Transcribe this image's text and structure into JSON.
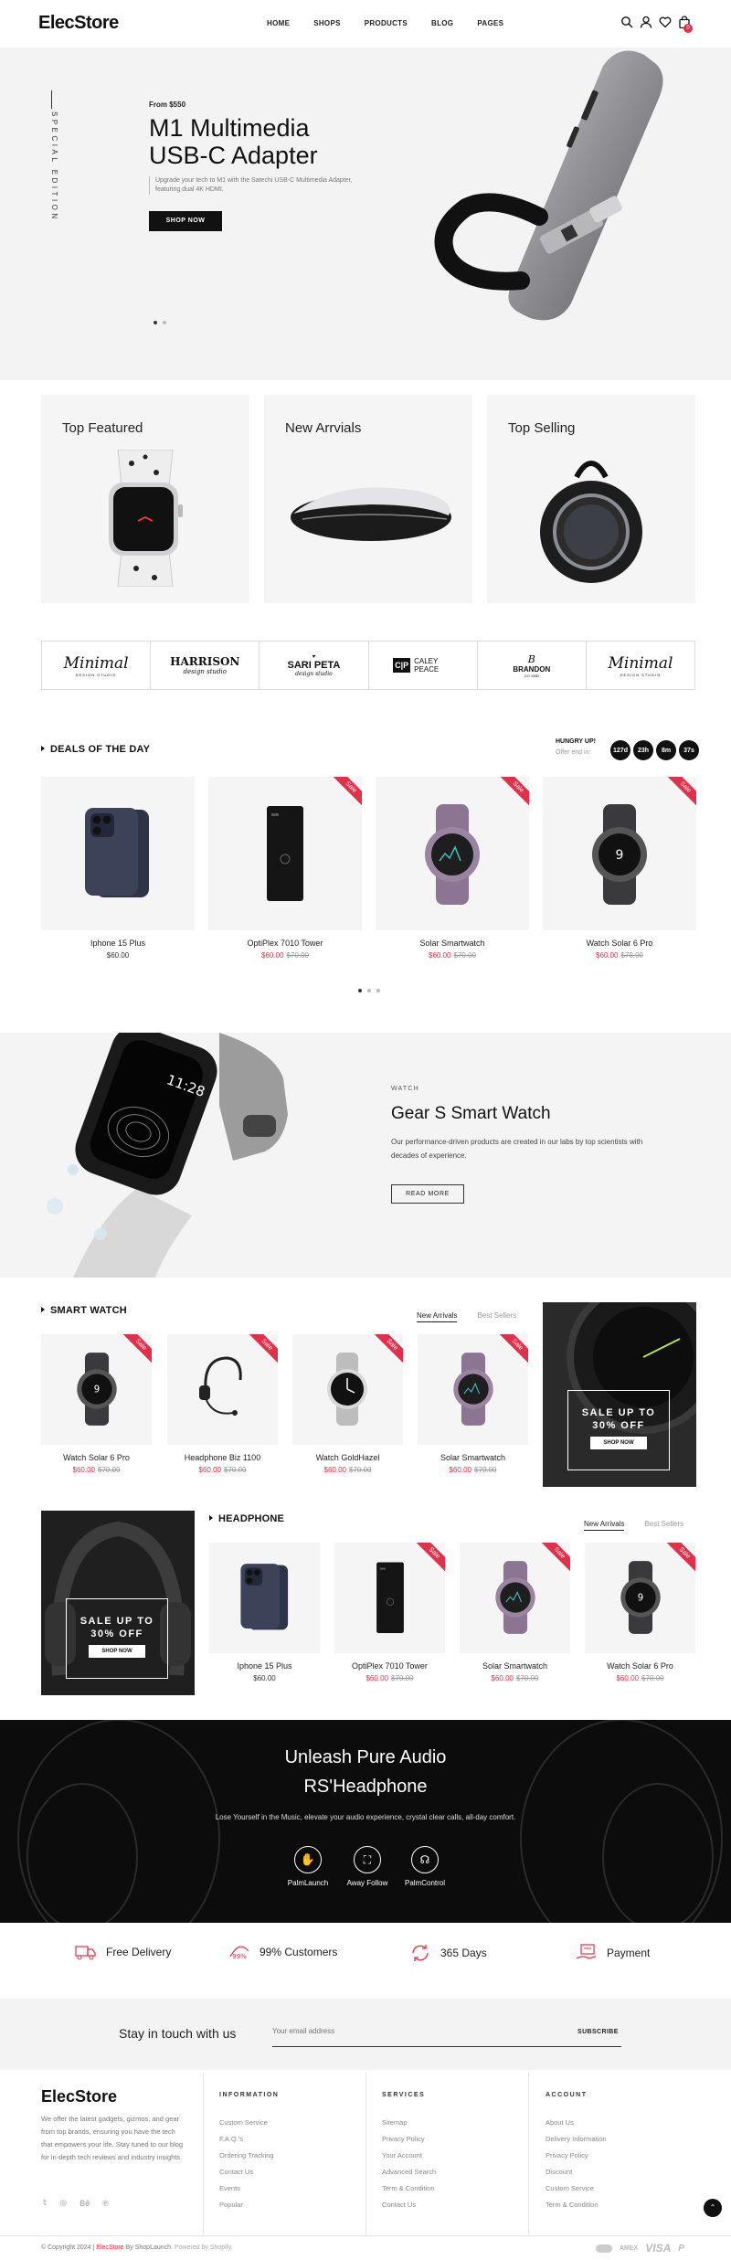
{
  "header": {
    "logo": "ElecStore",
    "nav": [
      "HOME",
      "SHOPS",
      "PRODUCTS",
      "BLOG",
      "PAGES"
    ],
    "cart_count": "0"
  },
  "hero": {
    "vertical_text": "SPECIAL EDITION",
    "price_line": "From $550",
    "title_line1": "M1 Multimedia",
    "title_line2": "USB-C Adapter",
    "description": "Upgrade your tech to M1 with the Satechi USB-C Multimedia Adapter, featuring dual 4K HDMI.",
    "button": "SHOP NOW"
  },
  "categories": [
    {
      "label": "Top Featured"
    },
    {
      "label": "New Arrvials"
    },
    {
      "label": "Top Selling"
    }
  ],
  "brands": [
    {
      "name": "Minimal",
      "sub": "DESIGN STUDIO"
    },
    {
      "name": "HARRISON",
      "sub": "design studio"
    },
    {
      "name": "SARI PETA",
      "sub": "design studio"
    },
    {
      "name": "CALEY PEACE",
      "sub": ""
    },
    {
      "name": "BRANDON",
      "sub": "CO 1980"
    },
    {
      "name": "Minimal",
      "sub": "DESIGN STUDIO"
    }
  ],
  "deals": {
    "title": "DEALS OF THE DAY",
    "hungry": "HUNGRY UP!",
    "offer": "Offer end in:",
    "timer": [
      "127d",
      "23h",
      "8m",
      "37s"
    ],
    "products": [
      {
        "name": "Iphone 15 Plus",
        "price": "$60.00",
        "old": "",
        "sale": false
      },
      {
        "name": "OptiPlex 7010 Tower",
        "price": "$60.00",
        "old": "$70.00",
        "sale": true
      },
      {
        "name": "Solar Smartwatch",
        "price": "$60.00",
        "old": "$70.00",
        "sale": true
      },
      {
        "name": "Watch Solar 6 Pro",
        "price": "$60.00",
        "old": "$70.00",
        "sale": true
      }
    ]
  },
  "watch_banner": {
    "tag": "WATCH",
    "title": "Gear S Smart Watch",
    "desc": "Our performance-driven products are created in our labs by top scientists with decades of experience.",
    "button": "READ MORE",
    "screen_time": "11:28"
  },
  "smartwatch": {
    "title": "SMART WATCH",
    "tab_new": "New Arrivals",
    "tab_best": "Best Sellers",
    "promo_line1": "SALE UP TO",
    "promo_line2": "30% OFF",
    "promo_button": "SHOP NOW",
    "products": [
      {
        "name": "Watch Solar 6 Pro",
        "price": "$60.00",
        "old": "$70.00"
      },
      {
        "name": "Headphone Biz 1100",
        "price": "$60.00",
        "old": "$70.00"
      },
      {
        "name": "Watch GoldHazel",
        "price": "$60.00",
        "old": "$70.00"
      },
      {
        "name": "Solar Smartwatch",
        "price": "$60.00",
        "old": "$70.00"
      }
    ]
  },
  "headphone": {
    "title": "HEADPHONE",
    "tab_new": "New Arrivals",
    "tab_best": "Best Sellers",
    "promo_line1": "SALE UP TO",
    "promo_line2": "30% OFF",
    "promo_button": "SHOP NOW",
    "products": [
      {
        "name": "Iphone 15 Plus",
        "price": "$60.00",
        "old": "",
        "sale": false
      },
      {
        "name": "OptiPlex 7010 Tower",
        "price": "$60.00",
        "old": "$70.00",
        "sale": true
      },
      {
        "name": "Solar Smartwatch",
        "price": "$60.00",
        "old": "$70.00",
        "sale": true
      },
      {
        "name": "Watch Solar 6 Pro",
        "price": "$60.00",
        "old": "$70.00",
        "sale": true
      }
    ]
  },
  "audio": {
    "line1": "Unleash Pure Audio",
    "line2": "RS'Headphone",
    "desc": "Lose Yourself in the Music, elevate your audio experience, crystal clear calls, all-day comfort.",
    "features": [
      "PalmLaunch",
      "Away Follow",
      "PalmControl"
    ]
  },
  "features": [
    "Free Delivery",
    "99% Customers",
    "365 Days",
    "Payment"
  ],
  "feature_badge": "99%",
  "newsletter": {
    "title": "Stay in touch with us",
    "placeholder": "Your email address",
    "button": "SUBSCRIBE"
  },
  "footer": {
    "logo": "ElecStore",
    "about": "We offer the latest gadgets, gizmos, and gear from top brands, ensuring you have the tech that empowers your life. Stay tuned to our blog for in-depth tech reviews and industry insights.",
    "info_title": "INFORMATION",
    "info": [
      "Custom Service",
      "F.A.Q.'s",
      "Ordering Tracking",
      "Contact Us",
      "Events",
      "Popular"
    ],
    "services_title": "SERVICES",
    "services": [
      "Sitemap",
      "Privacy Policy",
      "Your Account",
      "Advanced Search",
      "Term & Condition",
      "Contact Us"
    ],
    "account_title": "ACCOUNT",
    "account": [
      "About Us",
      "Delivery Information",
      "Privacy Policy",
      "Discount",
      "Custom Service",
      "Term & Condition"
    ],
    "copyright_pre": "© Copyright 2024 | ",
    "copyright_brand": "ElecStore",
    "copyright_by": " By ShopLaunch",
    "powered": ". Powered by Shopify.",
    "pay": [
      "AMEX",
      "VISA"
    ]
  },
  "colors": {
    "accent": "#e0314b",
    "dark": "#111111",
    "panel": "#f5f5f5"
  }
}
